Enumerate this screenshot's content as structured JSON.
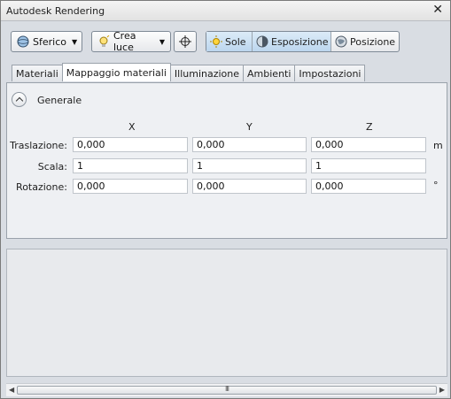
{
  "window": {
    "title": "Autodesk Rendering",
    "close_label": "✕"
  },
  "toolbar": {
    "spherical_label": "Sferico",
    "create_light_label": "Crea luce",
    "sun_label": "Sole",
    "exposure_label": "Esposizione",
    "location_label": "Posizione"
  },
  "tabs": [
    "Materiali",
    "Mappaggio materiali",
    "Illuminazione",
    "Ambienti",
    "Impostazioni"
  ],
  "active_tab": "Mappaggio materiali",
  "section": {
    "title": "Generale"
  },
  "columns": [
    "X",
    "Y",
    "Z"
  ],
  "rows": [
    {
      "label": "Traslazione:",
      "x": "0,000",
      "y": "0,000",
      "z": "0,000",
      "unit": "m"
    },
    {
      "label": "Scala:",
      "x": "1",
      "y": "1",
      "z": "1",
      "unit": ""
    },
    {
      "label": "Rotazione:",
      "x": "0,000",
      "y": "0,000",
      "z": "0,000",
      "unit": "°"
    }
  ],
  "scrollbar": {
    "grip": "III"
  }
}
